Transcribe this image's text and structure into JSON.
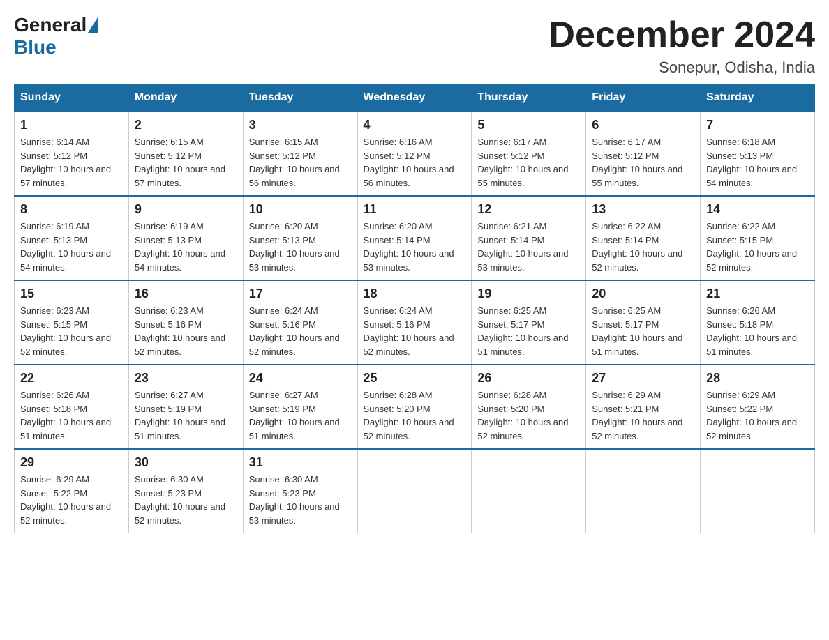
{
  "header": {
    "logo_general": "General",
    "logo_blue": "Blue",
    "month_title": "December 2024",
    "location": "Sonepur, Odisha, India"
  },
  "days_of_week": [
    "Sunday",
    "Monday",
    "Tuesday",
    "Wednesday",
    "Thursday",
    "Friday",
    "Saturday"
  ],
  "weeks": [
    [
      {
        "day": "1",
        "sunrise": "6:14 AM",
        "sunset": "5:12 PM",
        "daylight": "10 hours and 57 minutes."
      },
      {
        "day": "2",
        "sunrise": "6:15 AM",
        "sunset": "5:12 PM",
        "daylight": "10 hours and 57 minutes."
      },
      {
        "day": "3",
        "sunrise": "6:15 AM",
        "sunset": "5:12 PM",
        "daylight": "10 hours and 56 minutes."
      },
      {
        "day": "4",
        "sunrise": "6:16 AM",
        "sunset": "5:12 PM",
        "daylight": "10 hours and 56 minutes."
      },
      {
        "day": "5",
        "sunrise": "6:17 AM",
        "sunset": "5:12 PM",
        "daylight": "10 hours and 55 minutes."
      },
      {
        "day": "6",
        "sunrise": "6:17 AM",
        "sunset": "5:12 PM",
        "daylight": "10 hours and 55 minutes."
      },
      {
        "day": "7",
        "sunrise": "6:18 AM",
        "sunset": "5:13 PM",
        "daylight": "10 hours and 54 minutes."
      }
    ],
    [
      {
        "day": "8",
        "sunrise": "6:19 AM",
        "sunset": "5:13 PM",
        "daylight": "10 hours and 54 minutes."
      },
      {
        "day": "9",
        "sunrise": "6:19 AM",
        "sunset": "5:13 PM",
        "daylight": "10 hours and 54 minutes."
      },
      {
        "day": "10",
        "sunrise": "6:20 AM",
        "sunset": "5:13 PM",
        "daylight": "10 hours and 53 minutes."
      },
      {
        "day": "11",
        "sunrise": "6:20 AM",
        "sunset": "5:14 PM",
        "daylight": "10 hours and 53 minutes."
      },
      {
        "day": "12",
        "sunrise": "6:21 AM",
        "sunset": "5:14 PM",
        "daylight": "10 hours and 53 minutes."
      },
      {
        "day": "13",
        "sunrise": "6:22 AM",
        "sunset": "5:14 PM",
        "daylight": "10 hours and 52 minutes."
      },
      {
        "day": "14",
        "sunrise": "6:22 AM",
        "sunset": "5:15 PM",
        "daylight": "10 hours and 52 minutes."
      }
    ],
    [
      {
        "day": "15",
        "sunrise": "6:23 AM",
        "sunset": "5:15 PM",
        "daylight": "10 hours and 52 minutes."
      },
      {
        "day": "16",
        "sunrise": "6:23 AM",
        "sunset": "5:16 PM",
        "daylight": "10 hours and 52 minutes."
      },
      {
        "day": "17",
        "sunrise": "6:24 AM",
        "sunset": "5:16 PM",
        "daylight": "10 hours and 52 minutes."
      },
      {
        "day": "18",
        "sunrise": "6:24 AM",
        "sunset": "5:16 PM",
        "daylight": "10 hours and 52 minutes."
      },
      {
        "day": "19",
        "sunrise": "6:25 AM",
        "sunset": "5:17 PM",
        "daylight": "10 hours and 51 minutes."
      },
      {
        "day": "20",
        "sunrise": "6:25 AM",
        "sunset": "5:17 PM",
        "daylight": "10 hours and 51 minutes."
      },
      {
        "day": "21",
        "sunrise": "6:26 AM",
        "sunset": "5:18 PM",
        "daylight": "10 hours and 51 minutes."
      }
    ],
    [
      {
        "day": "22",
        "sunrise": "6:26 AM",
        "sunset": "5:18 PM",
        "daylight": "10 hours and 51 minutes."
      },
      {
        "day": "23",
        "sunrise": "6:27 AM",
        "sunset": "5:19 PM",
        "daylight": "10 hours and 51 minutes."
      },
      {
        "day": "24",
        "sunrise": "6:27 AM",
        "sunset": "5:19 PM",
        "daylight": "10 hours and 51 minutes."
      },
      {
        "day": "25",
        "sunrise": "6:28 AM",
        "sunset": "5:20 PM",
        "daylight": "10 hours and 52 minutes."
      },
      {
        "day": "26",
        "sunrise": "6:28 AM",
        "sunset": "5:20 PM",
        "daylight": "10 hours and 52 minutes."
      },
      {
        "day": "27",
        "sunrise": "6:29 AM",
        "sunset": "5:21 PM",
        "daylight": "10 hours and 52 minutes."
      },
      {
        "day": "28",
        "sunrise": "6:29 AM",
        "sunset": "5:22 PM",
        "daylight": "10 hours and 52 minutes."
      }
    ],
    [
      {
        "day": "29",
        "sunrise": "6:29 AM",
        "sunset": "5:22 PM",
        "daylight": "10 hours and 52 minutes."
      },
      {
        "day": "30",
        "sunrise": "6:30 AM",
        "sunset": "5:23 PM",
        "daylight": "10 hours and 52 minutes."
      },
      {
        "day": "31",
        "sunrise": "6:30 AM",
        "sunset": "5:23 PM",
        "daylight": "10 hours and 53 minutes."
      },
      null,
      null,
      null,
      null
    ]
  ],
  "labels": {
    "sunrise_prefix": "Sunrise: ",
    "sunset_prefix": "Sunset: ",
    "daylight_prefix": "Daylight: "
  }
}
